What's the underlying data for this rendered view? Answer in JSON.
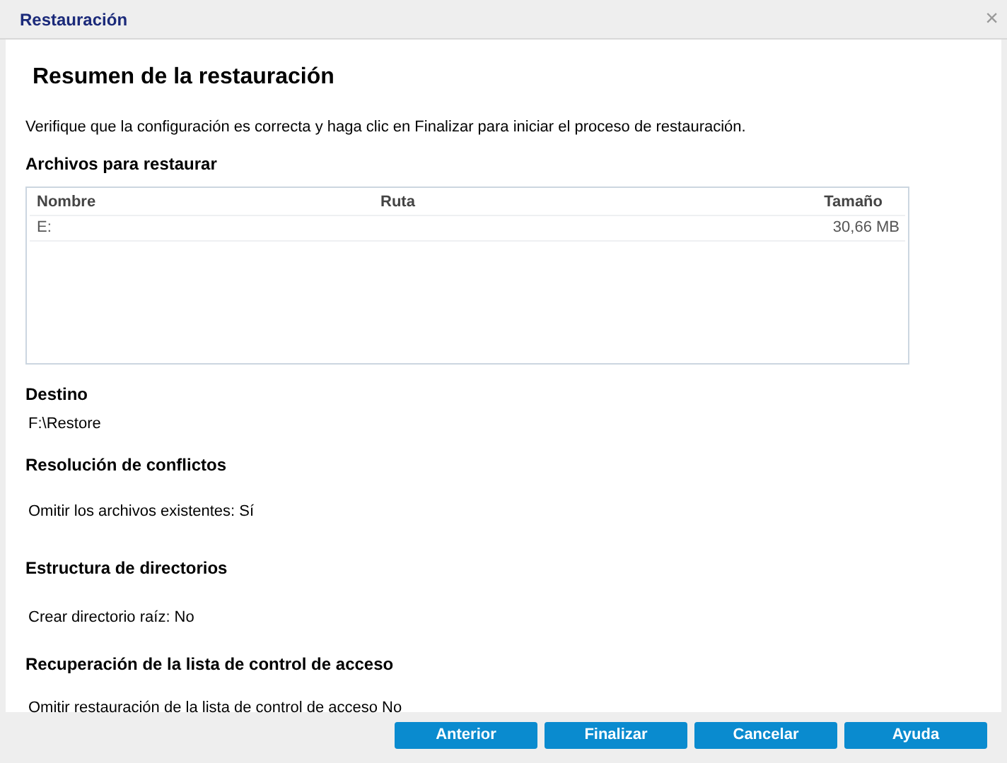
{
  "window": {
    "title": "Restauración",
    "close": "×"
  },
  "heading": "Resumen de la restauración",
  "intro": "Verifique que la configuración es correcta y haga clic en Finalizar para iniciar el proceso de restauración.",
  "files": {
    "title": "Archivos para restaurar",
    "columns": [
      "Nombre",
      "Ruta",
      "Tamaño"
    ],
    "rows": [
      [
        "E:",
        "",
        "30,66 MB"
      ]
    ]
  },
  "sections": [
    {
      "title": "Destino",
      "value": "F:\\Restore"
    },
    {
      "title": "Resolución de conflictos",
      "value": "Omitir los archivos existentes: Sí"
    },
    {
      "title": "Estructura de directorios",
      "value": "Crear directorio raíz: No"
    },
    {
      "title": "Recuperación de la lista de control de acceso",
      "value": "Omitir restauración de la lista de control de acceso No"
    }
  ],
  "buttons": [
    "Anterior",
    "Finalizar",
    "Cancelar",
    "Ayuda"
  ]
}
